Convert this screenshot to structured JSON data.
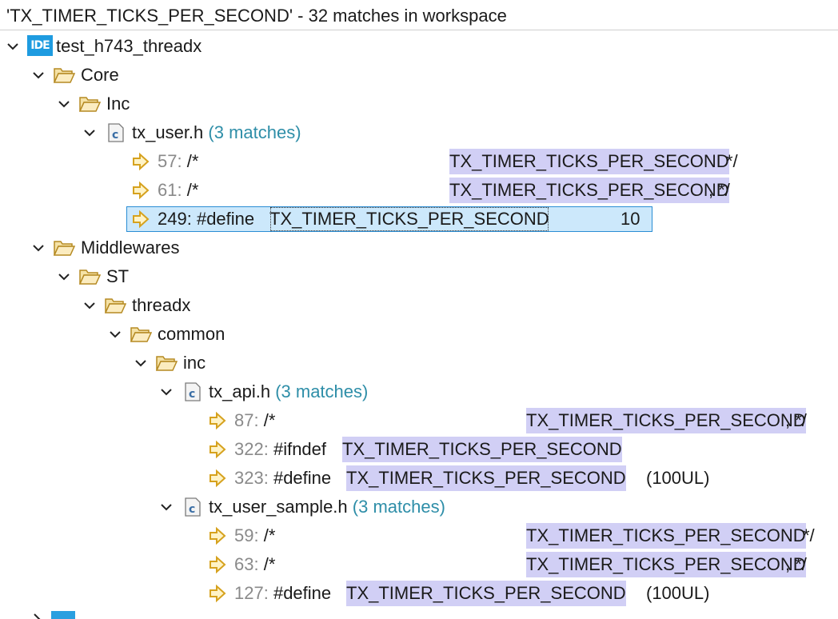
{
  "header": {
    "title": "'TX_TIMER_TICKS_PER_SECOND' - 32 matches in workspace"
  },
  "project": {
    "name": "test_h743_threadx",
    "badge": "IDE"
  },
  "folders": {
    "core": "Core",
    "inc_core": "Inc",
    "middlewares": "Middlewares",
    "st": "ST",
    "threadx": "threadx",
    "common": "common",
    "inc": "inc"
  },
  "files": {
    "tx_user": {
      "name": "tx_user.h",
      "count": "(3 matches)"
    },
    "tx_api": {
      "name": "tx_api.h",
      "count": "(3 matches)"
    },
    "tx_user_sample": {
      "name": "tx_user_sample.h",
      "count": "(3 matches)"
    }
  },
  "file_icon_letter": "c",
  "search_term": "TX_TIMER_TICKS_PER_SECOND",
  "matches": {
    "m57": {
      "line": "57:",
      "code": "/*",
      "tail": "*/"
    },
    "m61": {
      "line": "61:",
      "code": "/*",
      "tail": ",  */"
    },
    "m249": {
      "line": "249:",
      "code": "#define",
      "tail": "10"
    },
    "m87": {
      "line": "87:",
      "code": "/*",
      "tail": ",  */"
    },
    "m322": {
      "line": "322:",
      "code": "#ifndef",
      "tail": ""
    },
    "m323": {
      "line": "323:",
      "code": "#define",
      "tail": "(100UL)"
    },
    "m59": {
      "line": "59:",
      "code": "/*",
      "tail": "*/"
    },
    "m63": {
      "line": "63:",
      "code": "/*",
      "tail": ",  */"
    },
    "m127": {
      "line": "127:",
      "code": "#define",
      "tail": "(100UL)"
    }
  },
  "colors": {
    "highlight": "#d1cff5",
    "selection": "#cce8fb",
    "selection_border": "#2a8dd4",
    "match_count": "#2e8ea8",
    "folder": "#c9a13a",
    "arrow": "#d6a21e"
  },
  "icons": {
    "chevron_down": "chevron-down-icon",
    "chevron_right": "chevron-right-icon",
    "folder": "folder-open-icon",
    "file": "c-header-file-icon",
    "match": "match-arrow-icon",
    "project": "ide-project-icon"
  }
}
